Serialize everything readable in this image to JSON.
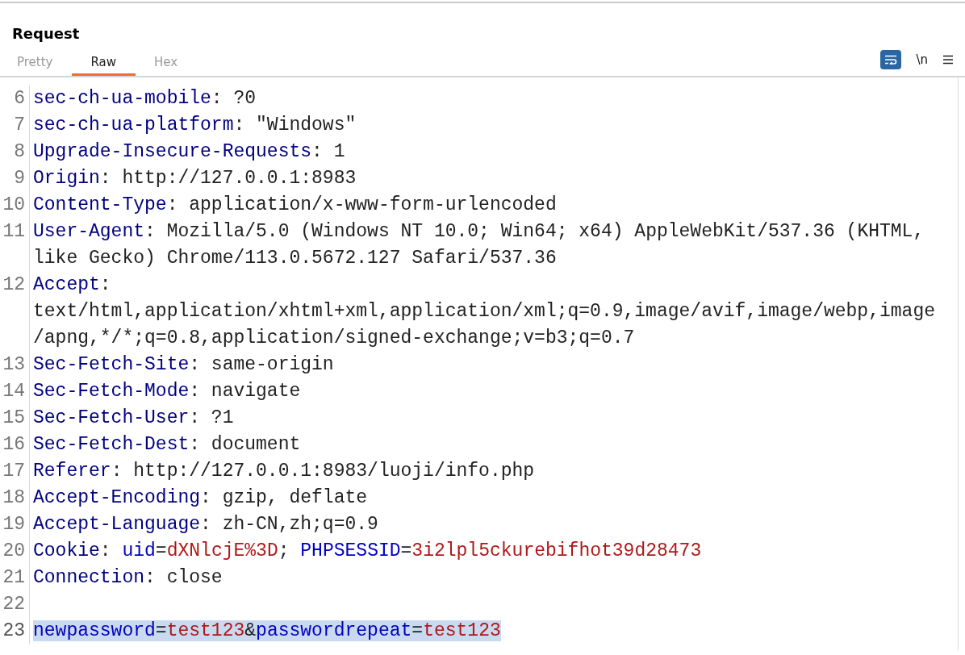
{
  "panel": {
    "title": "Request"
  },
  "tabs": [
    {
      "label": "Pretty",
      "selected": false
    },
    {
      "label": "Raw",
      "selected": true
    },
    {
      "label": "Hex",
      "selected": false
    }
  ],
  "toolbar": {
    "wrap_on": true,
    "newline_label": "\\n"
  },
  "lines": [
    {
      "number": "6",
      "selected": false,
      "rows": [
        [
          {
            "kind": "name",
            "text": "sec-ch-ua-mobile"
          },
          {
            "kind": "plain",
            "text": ": ?0"
          }
        ]
      ]
    },
    {
      "number": "7",
      "selected": false,
      "rows": [
        [
          {
            "kind": "name",
            "text": "sec-ch-ua-platform"
          },
          {
            "kind": "plain",
            "text": ": \"Windows\""
          }
        ]
      ]
    },
    {
      "number": "8",
      "selected": false,
      "rows": [
        [
          {
            "kind": "name",
            "text": "Upgrade-Insecure-Requests"
          },
          {
            "kind": "plain",
            "text": ": 1"
          }
        ]
      ]
    },
    {
      "number": "9",
      "selected": false,
      "rows": [
        [
          {
            "kind": "name",
            "text": "Origin"
          },
          {
            "kind": "plain",
            "text": ": http://127.0.0.1:8983"
          }
        ]
      ]
    },
    {
      "number": "10",
      "selected": false,
      "rows": [
        [
          {
            "kind": "name",
            "text": "Content-Type"
          },
          {
            "kind": "plain",
            "text": ": application/x-www-form-urlencoded"
          }
        ]
      ]
    },
    {
      "number": "11",
      "selected": false,
      "rows": [
        [
          {
            "kind": "name",
            "text": "User-Agent"
          },
          {
            "kind": "plain",
            "text": ": Mozilla/5.0 (Windows NT 10.0; Win64; x64) AppleWebKit/537.36 (KHTML,"
          }
        ],
        [
          {
            "kind": "plain",
            "text": "like Gecko) Chrome/113.0.5672.127 Safari/537.36"
          }
        ]
      ]
    },
    {
      "number": "12",
      "selected": false,
      "rows": [
        [
          {
            "kind": "name",
            "text": "Accept"
          },
          {
            "kind": "plain",
            "text": ":"
          }
        ],
        [
          {
            "kind": "plain",
            "text": "text/html,application/xhtml+xml,application/xml;q=0.9,image/avif,image/webp,image"
          }
        ],
        [
          {
            "kind": "plain",
            "text": "/apng,*/*;q=0.8,application/signed-exchange;v=b3;q=0.7"
          }
        ]
      ]
    },
    {
      "number": "13",
      "selected": false,
      "rows": [
        [
          {
            "kind": "name",
            "text": "Sec-Fetch-Site"
          },
          {
            "kind": "plain",
            "text": ": same-origin"
          }
        ]
      ]
    },
    {
      "number": "14",
      "selected": false,
      "rows": [
        [
          {
            "kind": "name",
            "text": "Sec-Fetch-Mode"
          },
          {
            "kind": "plain",
            "text": ": navigate"
          }
        ]
      ]
    },
    {
      "number": "15",
      "selected": false,
      "rows": [
        [
          {
            "kind": "name",
            "text": "Sec-Fetch-User"
          },
          {
            "kind": "plain",
            "text": ": ?1"
          }
        ]
      ]
    },
    {
      "number": "16",
      "selected": false,
      "rows": [
        [
          {
            "kind": "name",
            "text": "Sec-Fetch-Dest"
          },
          {
            "kind": "plain",
            "text": ": document"
          }
        ]
      ]
    },
    {
      "number": "17",
      "selected": false,
      "rows": [
        [
          {
            "kind": "name",
            "text": "Referer"
          },
          {
            "kind": "plain",
            "text": ": http://127.0.0.1:8983/luoji/info.php"
          }
        ]
      ]
    },
    {
      "number": "18",
      "selected": false,
      "rows": [
        [
          {
            "kind": "name",
            "text": "Accept-Encoding"
          },
          {
            "kind": "plain",
            "text": ": gzip, deflate"
          }
        ]
      ]
    },
    {
      "number": "19",
      "selected": false,
      "rows": [
        [
          {
            "kind": "name",
            "text": "Accept-Language"
          },
          {
            "kind": "plain",
            "text": ": zh-CN,zh;q=0.9"
          }
        ]
      ]
    },
    {
      "number": "20",
      "selected": false,
      "rows": [
        [
          {
            "kind": "name",
            "text": "Cookie"
          },
          {
            "kind": "plain",
            "text": ": "
          },
          {
            "kind": "param",
            "text": "uid"
          },
          {
            "kind": "plain",
            "text": "="
          },
          {
            "kind": "value",
            "text": "dXNlcjE%3D"
          },
          {
            "kind": "plain",
            "text": "; "
          },
          {
            "kind": "param",
            "text": "PHPSESSID"
          },
          {
            "kind": "plain",
            "text": "="
          },
          {
            "kind": "value",
            "text": "3i2lpl5ckurebifhot39d28473"
          }
        ]
      ]
    },
    {
      "number": "21",
      "selected": false,
      "rows": [
        [
          {
            "kind": "name",
            "text": "Connection"
          },
          {
            "kind": "plain",
            "text": ": close"
          }
        ]
      ]
    },
    {
      "number": "22",
      "selected": false
    },
    {
      "number": "23",
      "selected": true,
      "rows": [
        [
          {
            "kind": "param",
            "text": "newpassword"
          },
          {
            "kind": "plain",
            "text": "="
          },
          {
            "kind": "value",
            "text": "test123"
          },
          {
            "kind": "plain",
            "text": "&"
          },
          {
            "kind": "param",
            "text": "passwordrepeat"
          },
          {
            "kind": "plain",
            "text": "="
          },
          {
            "kind": "value",
            "text": "test123"
          }
        ]
      ]
    }
  ]
}
